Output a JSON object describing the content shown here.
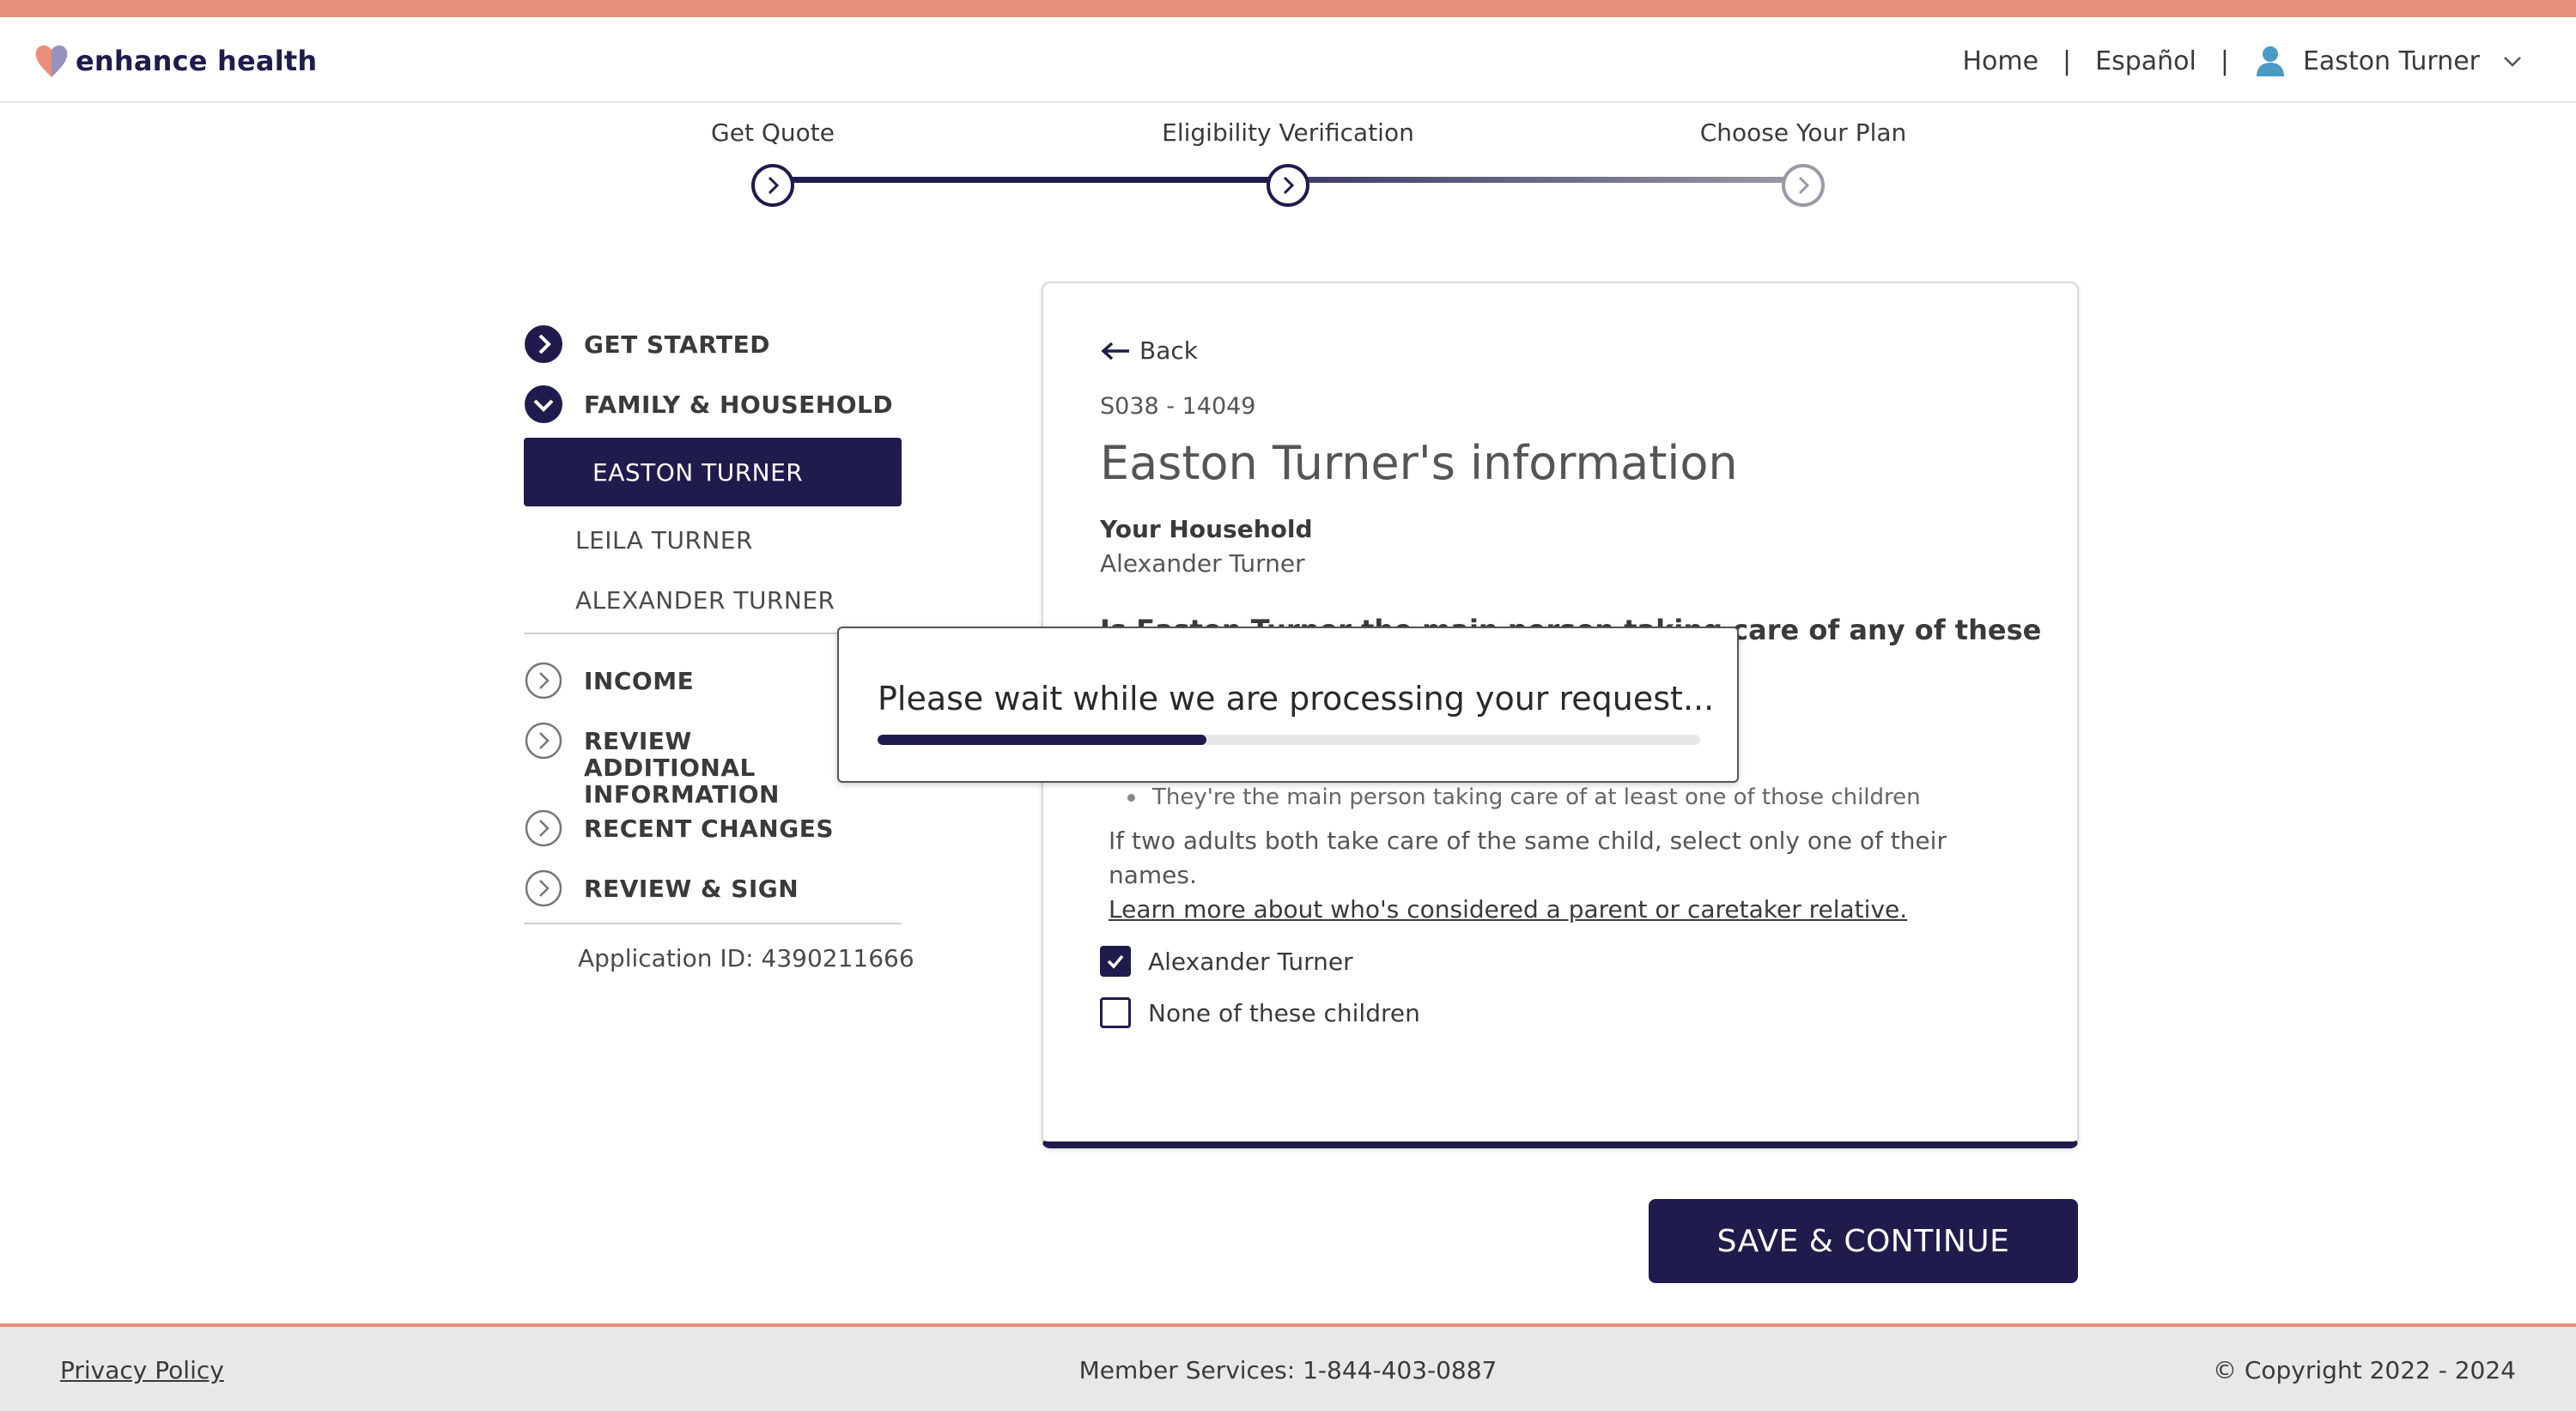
{
  "brand": {
    "name": "enhance health",
    "primary_color": "#1f1c4d",
    "accent_color": "#e8907c",
    "logo_icon": "heart-logo-icon"
  },
  "header": {
    "home_label": "Home",
    "language_label": "Español",
    "separator": "|",
    "user_name": "Easton Turner",
    "user_icon": "user-icon",
    "dropdown_icon": "chevron-down-icon"
  },
  "stepper": {
    "steps": [
      {
        "label": "Get Quote",
        "state": "complete"
      },
      {
        "label": "Eligibility Verification",
        "state": "current"
      },
      {
        "label": "Choose Your Plan",
        "state": "upcoming"
      }
    ]
  },
  "sidebar": {
    "sections": [
      {
        "label": "GET STARTED",
        "icon": "chevron-right-circle-filled-icon"
      },
      {
        "label": "FAMILY & HOUSEHOLD",
        "icon": "chevron-down-circle-filled-icon"
      },
      {
        "label": "INCOME",
        "icon": "chevron-right-circle-outline-icon"
      },
      {
        "label": "REVIEW ADDITIONAL INFORMATION",
        "icon": "chevron-right-circle-outline-icon"
      },
      {
        "label": "RECENT CHANGES",
        "icon": "chevron-right-circle-outline-icon"
      },
      {
        "label": "REVIEW & SIGN",
        "icon": "chevron-right-circle-outline-icon"
      }
    ],
    "members": [
      "EASTON TURNER",
      "LEILA TURNER",
      "ALEXANDER TURNER"
    ],
    "active_member": "EASTON TURNER",
    "application_id": "Application ID: 4390211666"
  },
  "form": {
    "back_label": "Back",
    "code": "S038 - 14049",
    "title": "Easton Turner's information",
    "household_label": "Your Household",
    "household_value": "Alexander Turner",
    "question": "Is Easton Turner the main person taking care of any of these",
    "bullet": "They're the main person taking care of at least one of those children",
    "note": "If two adults both take care of the same child, select only one of their names.",
    "learn_more": "Learn more about who's considered a parent or caretaker relative.",
    "options": [
      {
        "label": "Alexander Turner",
        "checked": true
      },
      {
        "label": "None of these children",
        "checked": false
      }
    ]
  },
  "modal": {
    "message": "Please wait while we are processing your request...",
    "progress": 0.4
  },
  "actions": {
    "save_label": "SAVE & CONTINUE"
  },
  "footer": {
    "privacy": "Privacy Policy",
    "member_services": "Member Services: 1-844-403-0887",
    "copyright": "© Copyright 2022 - 2024"
  }
}
